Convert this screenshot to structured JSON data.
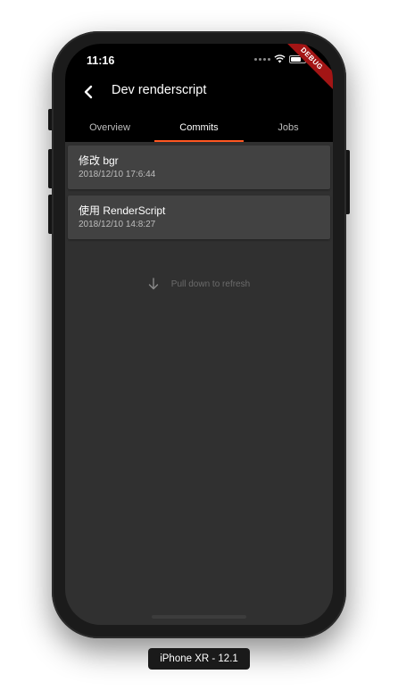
{
  "status_bar": {
    "time": "11:16",
    "icons": [
      "signal-dots-icon",
      "wifi-icon",
      "battery-icon"
    ]
  },
  "debug_banner": "DEBUG",
  "app_bar": {
    "back_icon": "chevron-left-icon",
    "title": "Dev renderscript"
  },
  "tabs": [
    {
      "label": "Overview",
      "active": false
    },
    {
      "label": "Commits",
      "active": true
    },
    {
      "label": "Jobs",
      "active": false
    }
  ],
  "commits": [
    {
      "message": "修改 bgr",
      "date": "2018/12/10 17:6:44"
    },
    {
      "message": "使用 RenderScript",
      "date": "2018/12/10 14:8:27"
    }
  ],
  "refresh_hint": {
    "icon": "arrow-down-icon",
    "text": "Pull down to refresh"
  },
  "device_label": "iPhone XR - 12.1",
  "colors": {
    "tab_indicator": "#ff5722",
    "app_bar_bg": "#000000",
    "screen_bg": "#303030",
    "card_bg": "#424242",
    "debug_ribbon": "#a31515"
  }
}
